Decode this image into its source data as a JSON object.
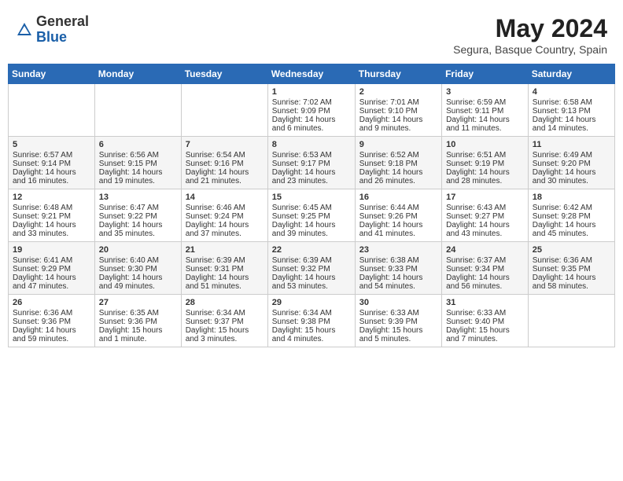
{
  "header": {
    "logo_general": "General",
    "logo_blue": "Blue",
    "title": "May 2024",
    "subtitle": "Segura, Basque Country, Spain"
  },
  "days_of_week": [
    "Sunday",
    "Monday",
    "Tuesday",
    "Wednesday",
    "Thursday",
    "Friday",
    "Saturday"
  ],
  "weeks": [
    [
      {
        "day": "",
        "sunrise": "",
        "sunset": "",
        "daylight": ""
      },
      {
        "day": "",
        "sunrise": "",
        "sunset": "",
        "daylight": ""
      },
      {
        "day": "",
        "sunrise": "",
        "sunset": "",
        "daylight": ""
      },
      {
        "day": "1",
        "sunrise": "Sunrise: 7:02 AM",
        "sunset": "Sunset: 9:09 PM",
        "daylight": "Daylight: 14 hours and 6 minutes."
      },
      {
        "day": "2",
        "sunrise": "Sunrise: 7:01 AM",
        "sunset": "Sunset: 9:10 PM",
        "daylight": "Daylight: 14 hours and 9 minutes."
      },
      {
        "day": "3",
        "sunrise": "Sunrise: 6:59 AM",
        "sunset": "Sunset: 9:11 PM",
        "daylight": "Daylight: 14 hours and 11 minutes."
      },
      {
        "day": "4",
        "sunrise": "Sunrise: 6:58 AM",
        "sunset": "Sunset: 9:13 PM",
        "daylight": "Daylight: 14 hours and 14 minutes."
      }
    ],
    [
      {
        "day": "5",
        "sunrise": "Sunrise: 6:57 AM",
        "sunset": "Sunset: 9:14 PM",
        "daylight": "Daylight: 14 hours and 16 minutes."
      },
      {
        "day": "6",
        "sunrise": "Sunrise: 6:56 AM",
        "sunset": "Sunset: 9:15 PM",
        "daylight": "Daylight: 14 hours and 19 minutes."
      },
      {
        "day": "7",
        "sunrise": "Sunrise: 6:54 AM",
        "sunset": "Sunset: 9:16 PM",
        "daylight": "Daylight: 14 hours and 21 minutes."
      },
      {
        "day": "8",
        "sunrise": "Sunrise: 6:53 AM",
        "sunset": "Sunset: 9:17 PM",
        "daylight": "Daylight: 14 hours and 23 minutes."
      },
      {
        "day": "9",
        "sunrise": "Sunrise: 6:52 AM",
        "sunset": "Sunset: 9:18 PM",
        "daylight": "Daylight: 14 hours and 26 minutes."
      },
      {
        "day": "10",
        "sunrise": "Sunrise: 6:51 AM",
        "sunset": "Sunset: 9:19 PM",
        "daylight": "Daylight: 14 hours and 28 minutes."
      },
      {
        "day": "11",
        "sunrise": "Sunrise: 6:49 AM",
        "sunset": "Sunset: 9:20 PM",
        "daylight": "Daylight: 14 hours and 30 minutes."
      }
    ],
    [
      {
        "day": "12",
        "sunrise": "Sunrise: 6:48 AM",
        "sunset": "Sunset: 9:21 PM",
        "daylight": "Daylight: 14 hours and 33 minutes."
      },
      {
        "day": "13",
        "sunrise": "Sunrise: 6:47 AM",
        "sunset": "Sunset: 9:22 PM",
        "daylight": "Daylight: 14 hours and 35 minutes."
      },
      {
        "day": "14",
        "sunrise": "Sunrise: 6:46 AM",
        "sunset": "Sunset: 9:24 PM",
        "daylight": "Daylight: 14 hours and 37 minutes."
      },
      {
        "day": "15",
        "sunrise": "Sunrise: 6:45 AM",
        "sunset": "Sunset: 9:25 PM",
        "daylight": "Daylight: 14 hours and 39 minutes."
      },
      {
        "day": "16",
        "sunrise": "Sunrise: 6:44 AM",
        "sunset": "Sunset: 9:26 PM",
        "daylight": "Daylight: 14 hours and 41 minutes."
      },
      {
        "day": "17",
        "sunrise": "Sunrise: 6:43 AM",
        "sunset": "Sunset: 9:27 PM",
        "daylight": "Daylight: 14 hours and 43 minutes."
      },
      {
        "day": "18",
        "sunrise": "Sunrise: 6:42 AM",
        "sunset": "Sunset: 9:28 PM",
        "daylight": "Daylight: 14 hours and 45 minutes."
      }
    ],
    [
      {
        "day": "19",
        "sunrise": "Sunrise: 6:41 AM",
        "sunset": "Sunset: 9:29 PM",
        "daylight": "Daylight: 14 hours and 47 minutes."
      },
      {
        "day": "20",
        "sunrise": "Sunrise: 6:40 AM",
        "sunset": "Sunset: 9:30 PM",
        "daylight": "Daylight: 14 hours and 49 minutes."
      },
      {
        "day": "21",
        "sunrise": "Sunrise: 6:39 AM",
        "sunset": "Sunset: 9:31 PM",
        "daylight": "Daylight: 14 hours and 51 minutes."
      },
      {
        "day": "22",
        "sunrise": "Sunrise: 6:39 AM",
        "sunset": "Sunset: 9:32 PM",
        "daylight": "Daylight: 14 hours and 53 minutes."
      },
      {
        "day": "23",
        "sunrise": "Sunrise: 6:38 AM",
        "sunset": "Sunset: 9:33 PM",
        "daylight": "Daylight: 14 hours and 54 minutes."
      },
      {
        "day": "24",
        "sunrise": "Sunrise: 6:37 AM",
        "sunset": "Sunset: 9:34 PM",
        "daylight": "Daylight: 14 hours and 56 minutes."
      },
      {
        "day": "25",
        "sunrise": "Sunrise: 6:36 AM",
        "sunset": "Sunset: 9:35 PM",
        "daylight": "Daylight: 14 hours and 58 minutes."
      }
    ],
    [
      {
        "day": "26",
        "sunrise": "Sunrise: 6:36 AM",
        "sunset": "Sunset: 9:36 PM",
        "daylight": "Daylight: 14 hours and 59 minutes."
      },
      {
        "day": "27",
        "sunrise": "Sunrise: 6:35 AM",
        "sunset": "Sunset: 9:36 PM",
        "daylight": "Daylight: 15 hours and 1 minute."
      },
      {
        "day": "28",
        "sunrise": "Sunrise: 6:34 AM",
        "sunset": "Sunset: 9:37 PM",
        "daylight": "Daylight: 15 hours and 3 minutes."
      },
      {
        "day": "29",
        "sunrise": "Sunrise: 6:34 AM",
        "sunset": "Sunset: 9:38 PM",
        "daylight": "Daylight: 15 hours and 4 minutes."
      },
      {
        "day": "30",
        "sunrise": "Sunrise: 6:33 AM",
        "sunset": "Sunset: 9:39 PM",
        "daylight": "Daylight: 15 hours and 5 minutes."
      },
      {
        "day": "31",
        "sunrise": "Sunrise: 6:33 AM",
        "sunset": "Sunset: 9:40 PM",
        "daylight": "Daylight: 15 hours and 7 minutes."
      },
      {
        "day": "",
        "sunrise": "",
        "sunset": "",
        "daylight": ""
      }
    ]
  ]
}
